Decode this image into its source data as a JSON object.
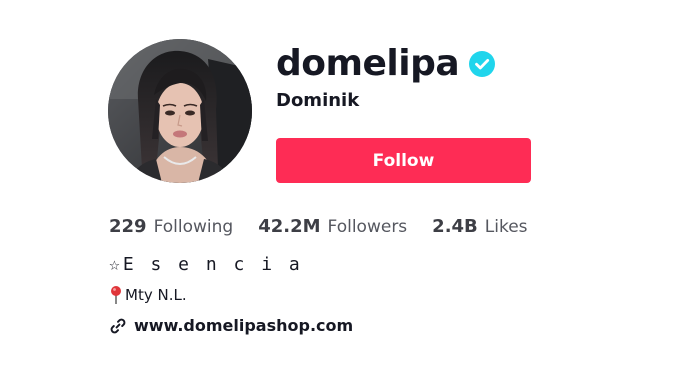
{
  "profile": {
    "username": "domelipa",
    "nickname": "Dominik",
    "verified": true,
    "avatar_alt": "profile photo"
  },
  "follow_button": {
    "label": "Follow",
    "color": "#fe2c55"
  },
  "stats": {
    "following": {
      "count": "229",
      "label": "Following"
    },
    "followers": {
      "count": "42.2M",
      "label": "Followers"
    },
    "likes": {
      "count": "2.4B",
      "label": "Likes"
    }
  },
  "bio": {
    "line1": "☆E s e n c i a",
    "location_text": "Mty N.L."
  },
  "link": {
    "text": "www.domelipashop.com"
  },
  "colors": {
    "verified_badge": "#20d5ec",
    "primary_text": "#161823"
  },
  "icons": {
    "verified": "verified-check-icon",
    "pin": "round-pushpin-icon",
    "link": "link-chain-icon"
  }
}
